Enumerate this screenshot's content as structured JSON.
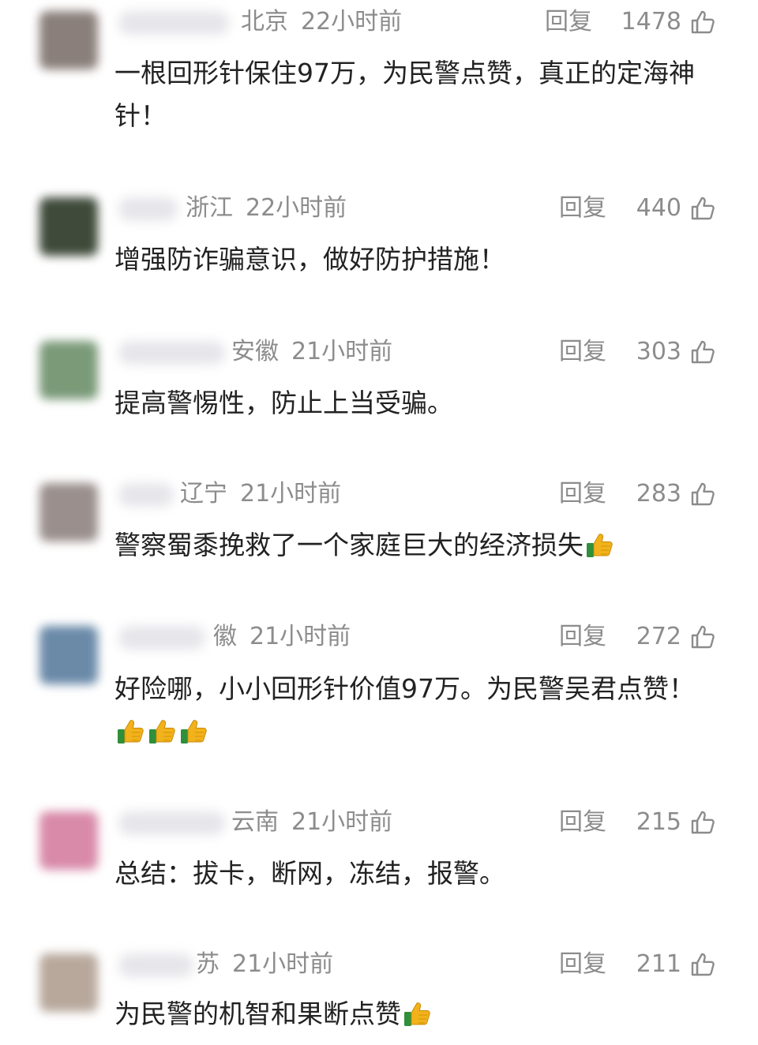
{
  "reply_label": "回复",
  "thumb_emoji": "thumbs-up-emoji",
  "comments": [
    {
      "location": "北京",
      "time": "22小时前",
      "likes": "1478",
      "text": "一根回形针保住97万，为民警点赞，真正的定海神针！",
      "emoji_count": 0,
      "avatar_color": "#8a7f7a"
    },
    {
      "location": "浙江",
      "time": "22小时前",
      "likes": "440",
      "text": "增强防诈骗意识，做好防护措施！",
      "emoji_count": 0,
      "avatar_color": "#3f4a3a"
    },
    {
      "location": "安徽",
      "time": "21小时前",
      "likes": "303",
      "text": "提高警惕性，防止上当受骗。",
      "emoji_count": 0,
      "avatar_color": "#7a9a78"
    },
    {
      "location": "辽宁",
      "time": "21小时前",
      "likes": "283",
      "text": "警察蜀黍挽救了一个家庭巨大的经济损失",
      "emoji_count": 1,
      "avatar_color": "#9a8f8c"
    },
    {
      "location": "徽",
      "time": "21小时前",
      "likes": "272",
      "text": "好险哪，小小回形针价值97万。为民警吴君点赞！",
      "emoji_count": 3,
      "avatar_color": "#6a8aa8"
    },
    {
      "location": "云南",
      "time": "21小时前",
      "likes": "215",
      "text": "总结：拔卡，断网，冻结，报警。",
      "emoji_count": 0,
      "avatar_color": "#d88aa8"
    },
    {
      "location": "苏",
      "time": "21小时前",
      "likes": "211",
      "text": "为民警的机智和果断点赞",
      "emoji_count": 1,
      "avatar_color": "#b8a89c"
    }
  ]
}
